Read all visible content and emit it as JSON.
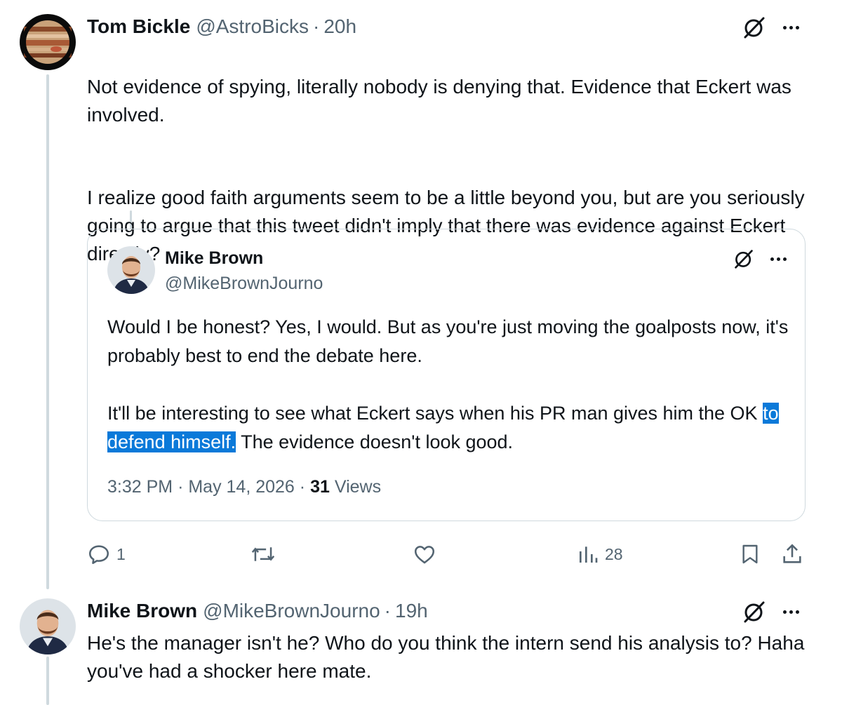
{
  "tweet1": {
    "display_name": "Tom Bickle",
    "handle": "@AstroBicks",
    "separator": "·",
    "time": "20h",
    "paragraphs": [
      "Not evidence of spying, literally nobody is denying that. Evidence that Eckert was involved.",
      "I realize good faith arguments seem to be a little beyond you, but are you seriously going to argue that this tweet didn't imply that there was evidence against Eckert directly?"
    ],
    "avatar_icon": "planet-avatar"
  },
  "quote": {
    "display_name": "Mike Brown",
    "handle": "@MikeBrownJourno",
    "paragraph1": "Would I be honest? Yes, I would. But as you're just moving the goalposts now, it's probably best to end the debate here.",
    "paragraph2_before": "It'll be interesting to see what Eckert says when his PR man gives him the OK ",
    "paragraph2_highlight": "to defend himself.",
    "paragraph2_after": " The evidence doesn't look good.",
    "time": "3:32 PM",
    "separator": "·",
    "date": "May 14, 2026",
    "views_count": "31",
    "views_label": "Views"
  },
  "actions": {
    "reply_count": "1",
    "retweet_count": "",
    "like_count": "",
    "views_count": "28"
  },
  "tweet2": {
    "display_name": "Mike Brown",
    "handle": "@MikeBrownJourno",
    "separator": "·",
    "time": "19h",
    "text": "He's the manager isn't he? Who do you think the intern send his analysis to? Haha you've had a shocker here mate."
  },
  "colors": {
    "text": "#0f1419",
    "secondary": "#536471",
    "border": "#cfd9de",
    "highlight": "#0a79d9"
  }
}
